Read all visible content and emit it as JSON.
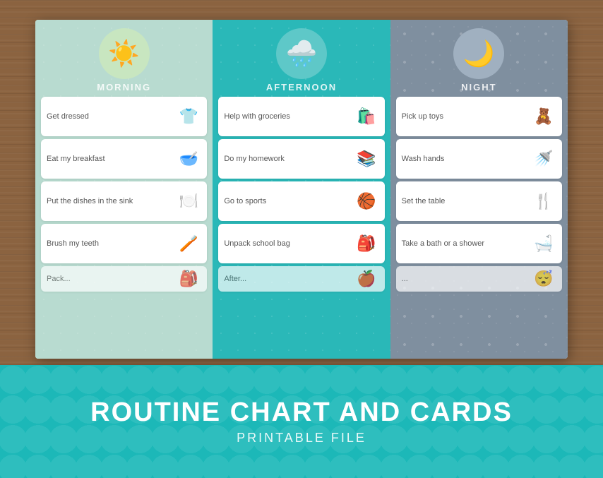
{
  "cols": [
    {
      "id": "morning",
      "title": "MORNING",
      "icon": "☀️",
      "iconClass": "morning-circle",
      "colorClass": "col-morning",
      "tasks": [
        {
          "text": "Get dressed",
          "icon": "👕"
        },
        {
          "text": "Eat my breakfast",
          "icon": "🥣"
        },
        {
          "text": "Put the dishes in the sink",
          "icon": "🍽️"
        },
        {
          "text": "Brush my teeth",
          "icon": "🪥"
        },
        {
          "text": "Pack...",
          "icon": "🎒",
          "partial": true
        }
      ]
    },
    {
      "id": "afternoon",
      "title": "AFTERNOON",
      "icon": "🌧️",
      "iconClass": "afternoon-circle",
      "colorClass": "col-afternoon",
      "tasks": [
        {
          "text": "Help with groceries",
          "icon": "🛍️"
        },
        {
          "text": "Do my homework",
          "icon": "📚"
        },
        {
          "text": "Go to sports",
          "icon": "🏀"
        },
        {
          "text": "Unpack school bag",
          "icon": "🎒"
        },
        {
          "text": "After...",
          "icon": "🍎",
          "partial": true
        }
      ]
    },
    {
      "id": "night",
      "title": "NIGHT",
      "icon": "🌙",
      "iconClass": "night-circle",
      "colorClass": "col-night",
      "tasks": [
        {
          "text": "Pick up toys",
          "icon": "🧸"
        },
        {
          "text": "Wash hands",
          "icon": "🚿"
        },
        {
          "text": "Set the table",
          "icon": "🍴"
        },
        {
          "text": "Take a bath or a shower",
          "icon": "🛁"
        },
        {
          "text": "...",
          "icon": "😴",
          "partial": true
        }
      ]
    }
  ],
  "banner": {
    "title": "ROUTINE CHART AND CARDS",
    "subtitle": "PRINTABLE FILE"
  }
}
